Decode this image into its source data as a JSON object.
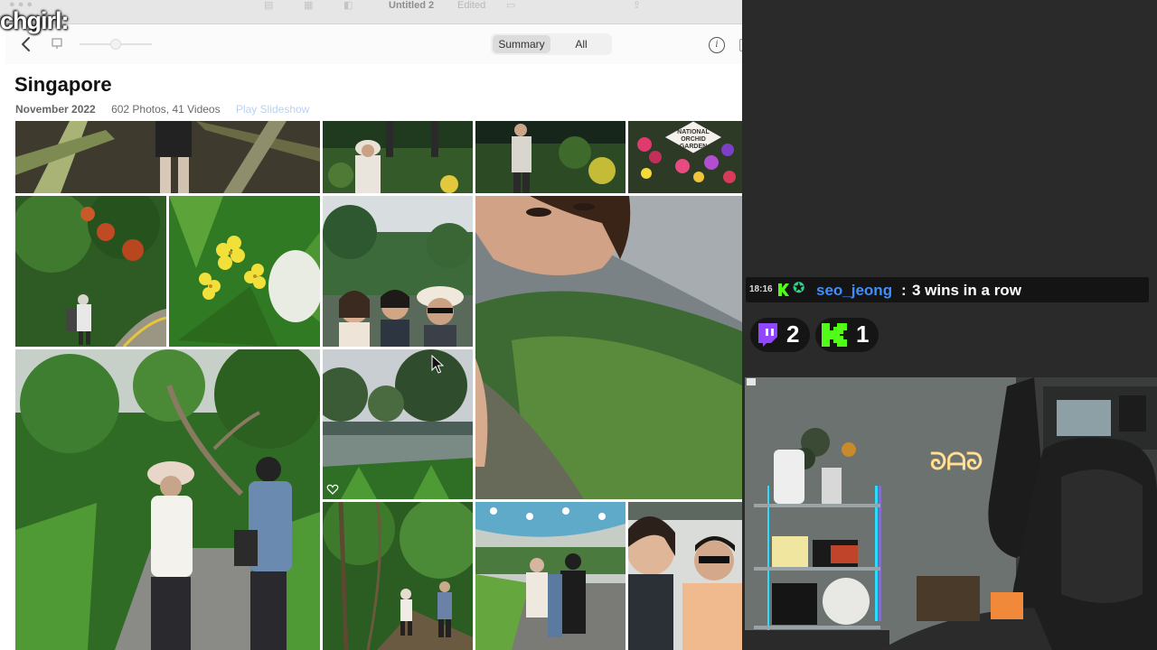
{
  "window": {
    "title": "Untitled 2",
    "status": "Edited"
  },
  "overlay": {
    "watermark": "chgirl:"
  },
  "toolbar": {
    "view_options": [
      {
        "label": "Summary",
        "selected": true
      },
      {
        "label": "All",
        "selected": false
      }
    ]
  },
  "album": {
    "title": "Singapore",
    "date": "November 2022",
    "count": "602 Photos, 41 Videos",
    "slideshow": "Play Slideshow"
  },
  "photos": [
    "palm-garden-walk",
    "garden-visitor-1",
    "garden-visitor-2",
    "national-orchid-garden-sign",
    "garden-path-couple",
    "yellow-flowers",
    "three-friends-selfie",
    "tilted-selfie-lake",
    "two-women-walking",
    "garden-lake",
    "forest-trail",
    "umbrella-group",
    "two-friends-selfie"
  ],
  "chat": {
    "time": "18:16",
    "username": "seo_jeong",
    "separator": ":",
    "message": "3 wins in a row",
    "badge_color": "#53fc18",
    "username_color": "#3d8fff"
  },
  "platforms": [
    {
      "name": "twitch",
      "count": "2",
      "color": "#9146ff"
    },
    {
      "name": "kick",
      "count": "1",
      "color": "#53fc18"
    }
  ],
  "webcam": {
    "neon_sign": "ᘐᗩᘐ"
  }
}
